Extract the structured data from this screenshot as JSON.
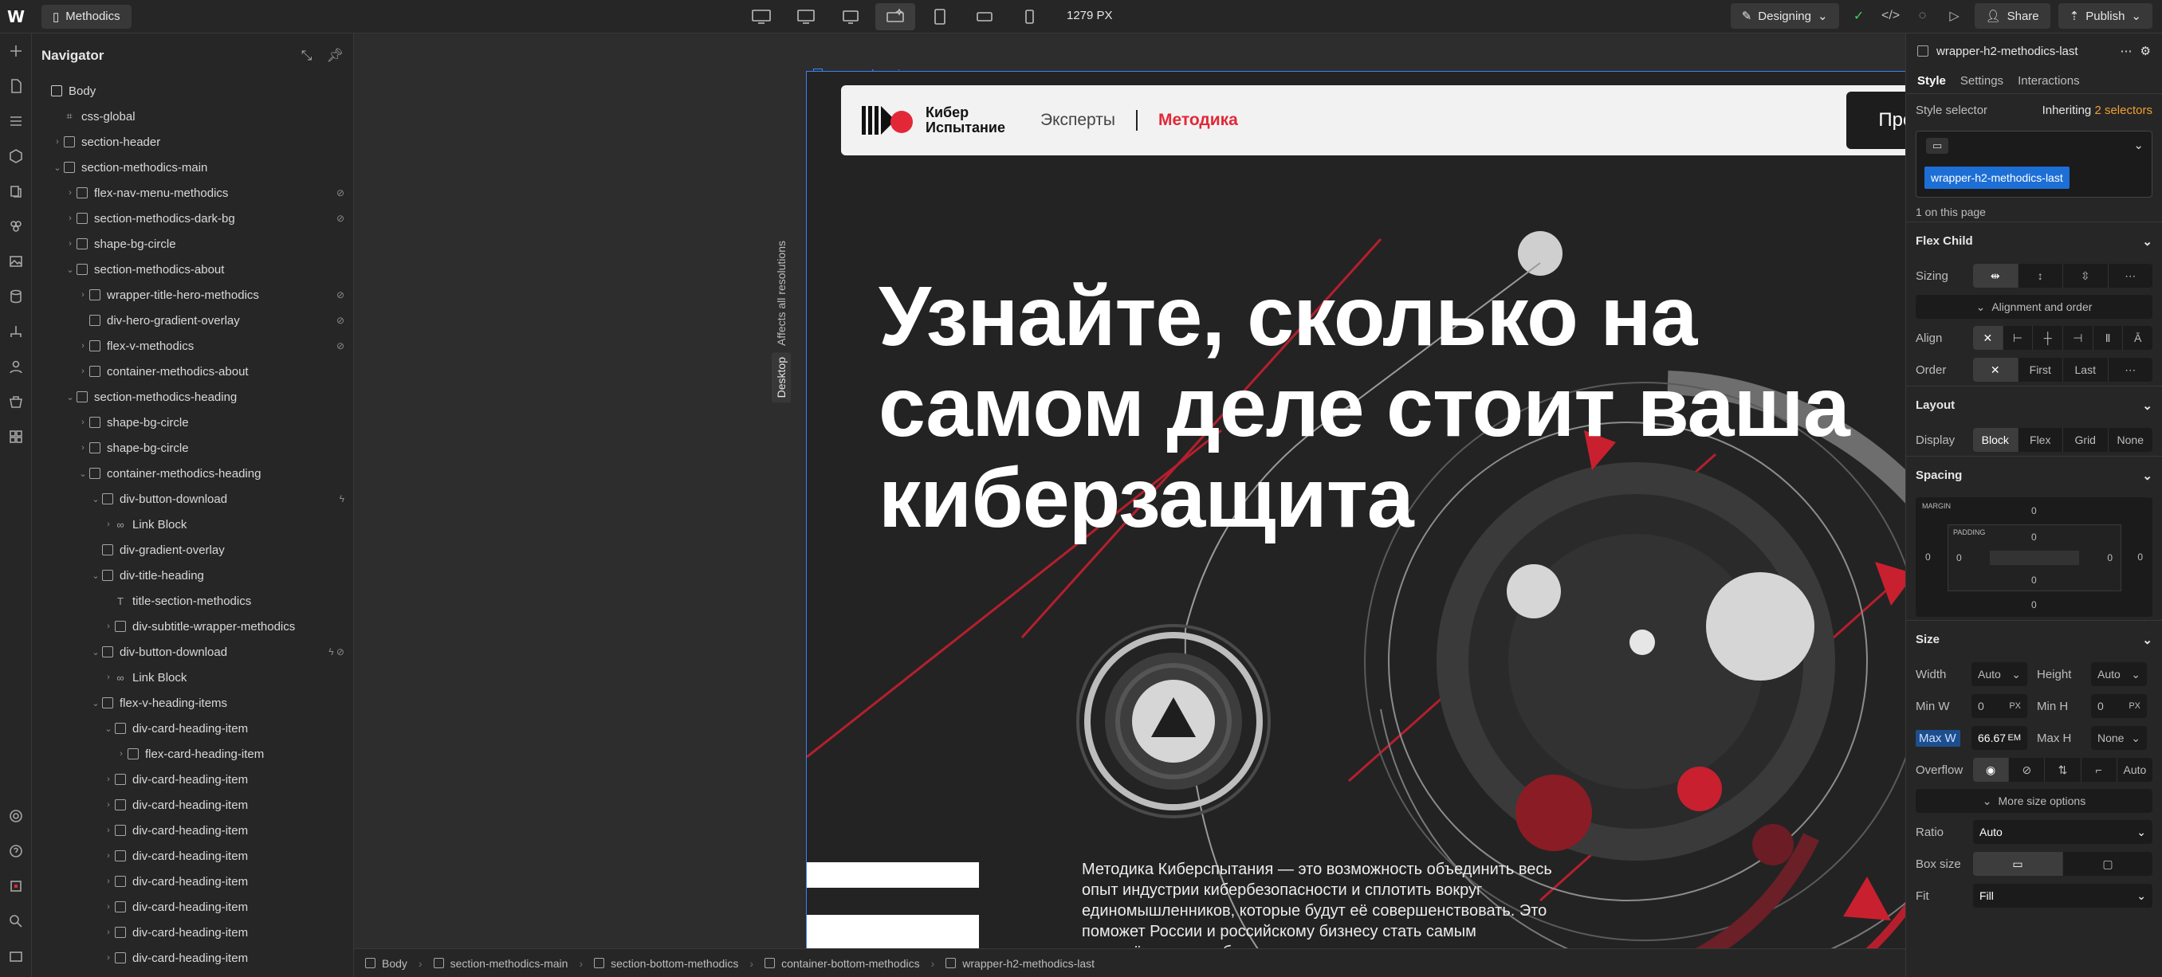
{
  "topbar": {
    "logo": "W",
    "page_name": "Methodics",
    "width_readout": "1279 PX",
    "mode_label": "Designing",
    "share_label": "Share",
    "publish_label": "Publish"
  },
  "navigator": {
    "title": "Navigator",
    "nodes": [
      {
        "label": "Body",
        "depth": 0,
        "caret": "",
        "kind": "box"
      },
      {
        "label": "css-global",
        "depth": 1,
        "caret": "",
        "kind": "code"
      },
      {
        "label": "section-header",
        "depth": 1,
        "caret": "›",
        "kind": "box"
      },
      {
        "label": "section-methodics-main",
        "depth": 1,
        "caret": "⌄",
        "kind": "box"
      },
      {
        "label": "flex-nav-menu-methodics",
        "depth": 2,
        "caret": "›",
        "kind": "box",
        "flag": "⊘"
      },
      {
        "label": "section-methodics-dark-bg",
        "depth": 2,
        "caret": "›",
        "kind": "box",
        "flag": "⊘"
      },
      {
        "label": "shape-bg-circle",
        "depth": 2,
        "caret": "›",
        "kind": "box"
      },
      {
        "label": "section-methodics-about",
        "depth": 2,
        "caret": "⌄",
        "kind": "box"
      },
      {
        "label": "wrapper-title-hero-methodics",
        "depth": 3,
        "caret": "›",
        "kind": "box",
        "flag": "⊘"
      },
      {
        "label": "div-hero-gradient-overlay",
        "depth": 3,
        "caret": "",
        "kind": "box",
        "flag": "⊘"
      },
      {
        "label": "flex-v-methodics",
        "depth": 3,
        "caret": "›",
        "kind": "box",
        "flag": "⊘"
      },
      {
        "label": "container-methodics-about",
        "depth": 3,
        "caret": "›",
        "kind": "box"
      },
      {
        "label": "section-methodics-heading",
        "depth": 2,
        "caret": "⌄",
        "kind": "box"
      },
      {
        "label": "shape-bg-circle",
        "depth": 3,
        "caret": "›",
        "kind": "box"
      },
      {
        "label": "shape-bg-circle",
        "depth": 3,
        "caret": "›",
        "kind": "box"
      },
      {
        "label": "container-methodics-heading",
        "depth": 3,
        "caret": "⌄",
        "kind": "box"
      },
      {
        "label": "div-button-download",
        "depth": 4,
        "caret": "⌄",
        "kind": "box",
        "flag": "ϟ"
      },
      {
        "label": "Link Block",
        "depth": 5,
        "caret": "›",
        "kind": "link"
      },
      {
        "label": "div-gradient-overlay",
        "depth": 4,
        "caret": "",
        "kind": "box"
      },
      {
        "label": "div-title-heading",
        "depth": 4,
        "caret": "⌄",
        "kind": "box"
      },
      {
        "label": "title-section-methodics",
        "depth": 5,
        "caret": "",
        "kind": "text"
      },
      {
        "label": "div-subtitle-wrapper-methodics",
        "depth": 5,
        "caret": "›",
        "kind": "box"
      },
      {
        "label": "div-button-download",
        "depth": 4,
        "caret": "⌄",
        "kind": "box",
        "flag": "ϟ ⊘"
      },
      {
        "label": "Link Block",
        "depth": 5,
        "caret": "›",
        "kind": "link"
      },
      {
        "label": "flex-v-heading-items",
        "depth": 4,
        "caret": "⌄",
        "kind": "box"
      },
      {
        "label": "div-card-heading-item",
        "depth": 5,
        "caret": "⌄",
        "kind": "box"
      },
      {
        "label": "flex-card-heading-item",
        "depth": 6,
        "caret": "›",
        "kind": "box"
      },
      {
        "label": "div-card-heading-item",
        "depth": 5,
        "caret": "›",
        "kind": "box"
      },
      {
        "label": "div-card-heading-item",
        "depth": 5,
        "caret": "›",
        "kind": "box"
      },
      {
        "label": "div-card-heading-item",
        "depth": 5,
        "caret": "›",
        "kind": "box"
      },
      {
        "label": "div-card-heading-item",
        "depth": 5,
        "caret": "›",
        "kind": "box"
      },
      {
        "label": "div-card-heading-item",
        "depth": 5,
        "caret": "›",
        "kind": "box"
      },
      {
        "label": "div-card-heading-item",
        "depth": 5,
        "caret": "›",
        "kind": "box"
      },
      {
        "label": "div-card-heading-item",
        "depth": 5,
        "caret": "›",
        "kind": "box"
      },
      {
        "label": "div-card-heading-item",
        "depth": 5,
        "caret": "›",
        "kind": "box"
      }
    ]
  },
  "canvas": {
    "affects_label": "Affects all resolutions",
    "breakpoint_label": "Desktop",
    "selected_label": "wrapper-hero-image",
    "site": {
      "brand_line1": "Кибер",
      "brand_line2": "Испытание",
      "nav_experts": "Эксперты",
      "nav_method": "Методика",
      "cta": "Предложить улучшения",
      "hero_title": "Узнайте, сколько на самом деле стоит ваша киберзащита",
      "hero_text": "Методика Киберcпытания — это возможность объединить весь опыт индустрии кибербезопасности и сплотить вокруг единомышленников, которые будут её совершенствовать. Это поможет России и российскому бизнесу стать самым защищённым от киберугроз в мире."
    }
  },
  "breadcrumbs": [
    "Body",
    "section-methodics-main",
    "section-bottom-methodics",
    "container-bottom-methodics",
    "wrapper-h2-methodics-last"
  ],
  "panel": {
    "element_name": "wrapper-h2-methodics-last",
    "tabs": [
      "Style",
      "Settings",
      "Interactions"
    ],
    "style_selector_label": "Style selector",
    "inheriting": "Inheriting",
    "selectors_count": "2 selectors",
    "selector_chip": "wrapper-h2-methodics-last",
    "on_page": "1 on this page",
    "flex_child": {
      "title": "Flex Child",
      "sizing": "Sizing",
      "alignment_btn": "Alignment and order",
      "align": "Align",
      "order": "Order",
      "order_opts": [
        "✕",
        "First",
        "Last"
      ]
    },
    "layout": {
      "title": "Layout",
      "display": "Display",
      "display_opts": [
        "Block",
        "Flex",
        "Grid",
        "None"
      ]
    },
    "spacing": {
      "title": "Spacing",
      "margin_label": "MARGIN",
      "padding_label": "PADDING",
      "values": [
        "0",
        "0",
        "0",
        "0",
        "0",
        "0",
        "0",
        "0"
      ]
    },
    "size": {
      "title": "Size",
      "width": "Width",
      "width_val": "Auto",
      "height": "Height",
      "height_val": "Auto",
      "min_w": "Min W",
      "min_w_val": "0",
      "min_w_unit": "PX",
      "min_h": "Min H",
      "min_h_val": "0",
      "min_h_unit": "PX",
      "max_w": "Max W",
      "max_w_val": "66.67",
      "max_w_unit": "EM",
      "max_h": "Max H",
      "max_h_val": "None",
      "overflow": "Overflow",
      "overflow_auto": "Auto",
      "more_btn": "More size options",
      "ratio": "Ratio",
      "ratio_val": "Auto",
      "box_size": "Box size",
      "fit": "Fit",
      "fit_val": "Fill"
    }
  }
}
